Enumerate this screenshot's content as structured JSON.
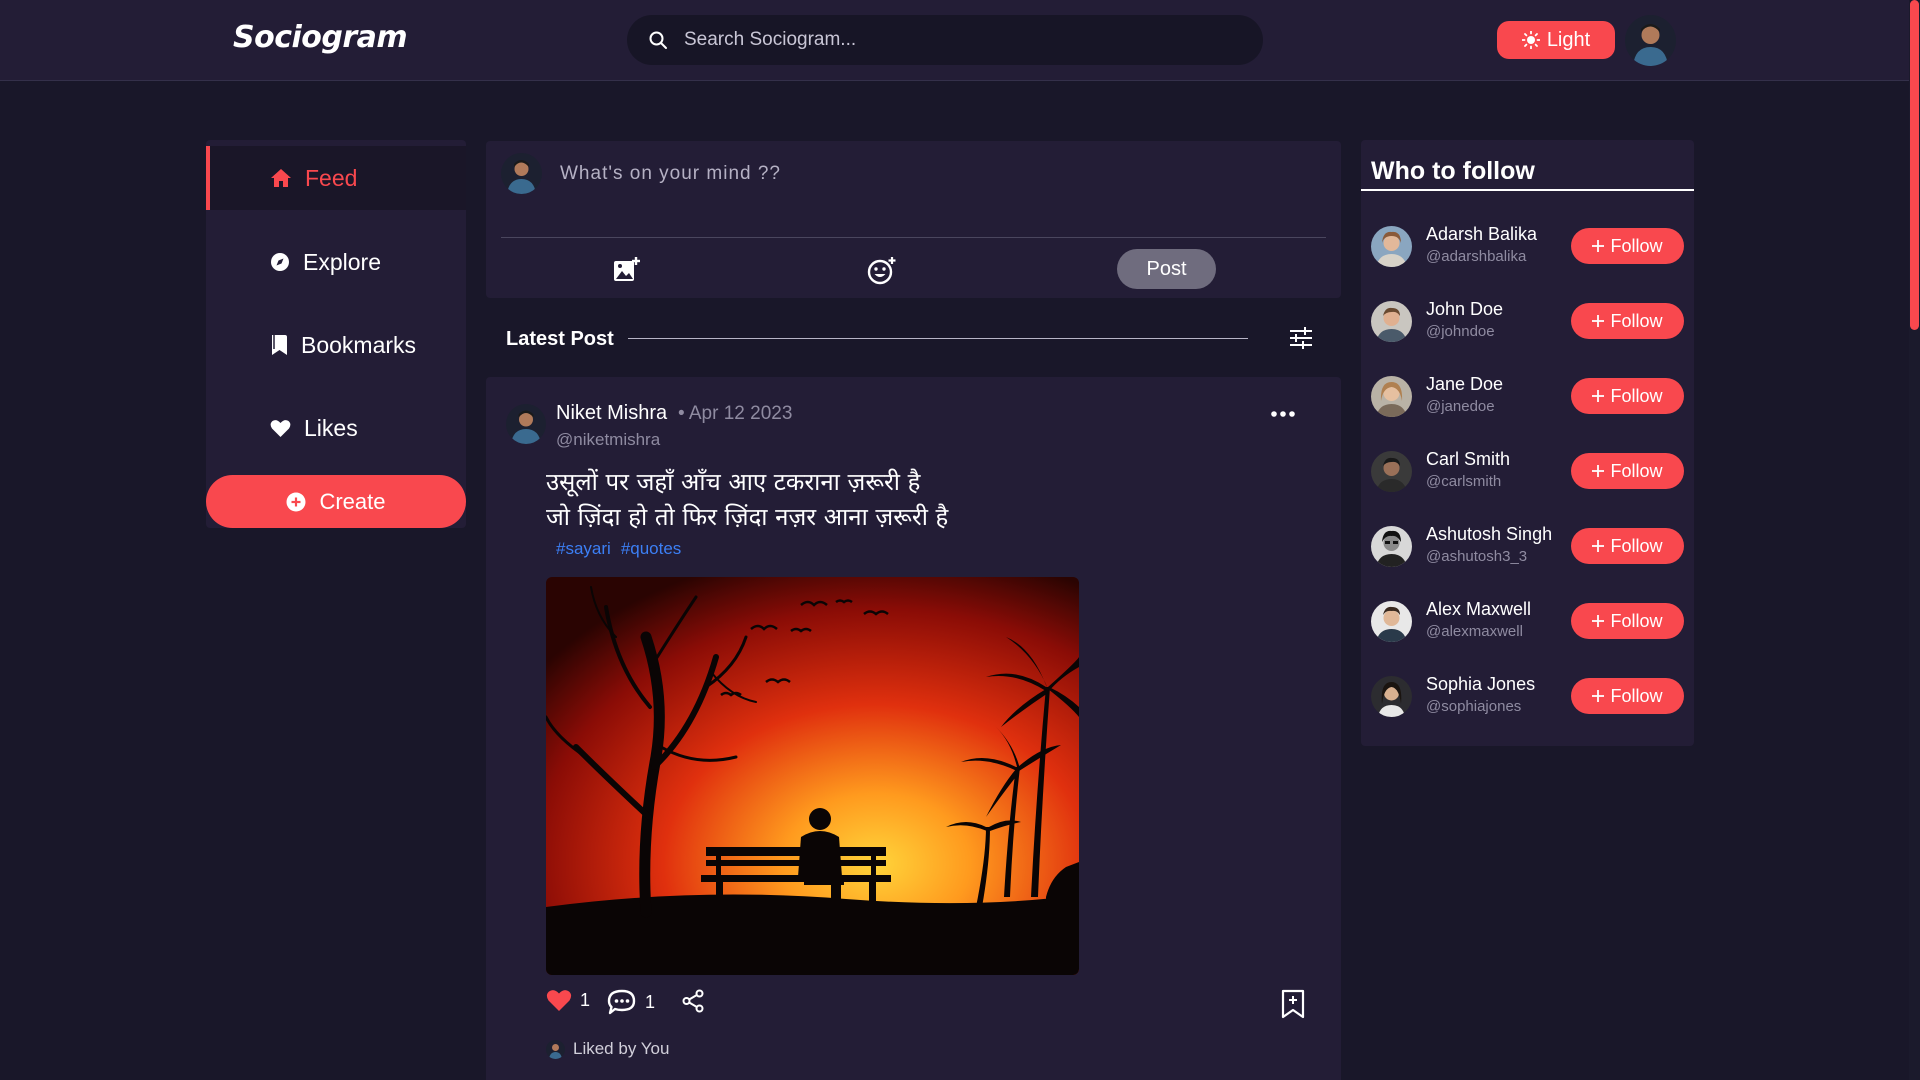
{
  "app": {
    "logo": "Sociogram",
    "theme_button_label": "Light"
  },
  "search": {
    "placeholder": "Search Sociogram..."
  },
  "sidebar": {
    "items": [
      {
        "label": "Feed",
        "icon": "home-icon",
        "active": true
      },
      {
        "label": "Explore",
        "icon": "compass-icon",
        "active": false
      },
      {
        "label": "Bookmarks",
        "icon": "bookmark-icon",
        "active": false
      },
      {
        "label": "Likes",
        "icon": "heart-icon",
        "active": false
      }
    ],
    "create_label": "Create"
  },
  "composer": {
    "placeholder": "What's on your mind ??",
    "post_label": "Post"
  },
  "feed": {
    "header": "Latest Post"
  },
  "post": {
    "author_name": "Niket Mishra",
    "date": "• Apr 12 2023",
    "handle": "@niketmishra",
    "line1": "उसूलों पर जहाँ आँच आए टकराना ज़रूरी है",
    "line2": "जो ज़िंदा हो तो फिर ज़िंदा नज़र आना ज़रूरी है",
    "tags": [
      "#sayari",
      "#quotes"
    ],
    "like_count": "1",
    "comment_count": "1",
    "liked_by": "Liked by You"
  },
  "who_to_follow": {
    "title": "Who to follow",
    "follow_label": "Follow",
    "users": [
      {
        "name": "Adarsh Balika",
        "handle": "@adarshbalika"
      },
      {
        "name": "John Doe",
        "handle": "@johndoe"
      },
      {
        "name": "Jane Doe",
        "handle": "@janedoe"
      },
      {
        "name": "Carl Smith",
        "handle": "@carlsmith"
      },
      {
        "name": "Ashutosh Singh",
        "handle": "@ashutosh3_3"
      },
      {
        "name": "Alex Maxwell",
        "handle": "@alexmaxwell"
      },
      {
        "name": "Sophia Jones",
        "handle": "@sophiajones"
      }
    ]
  },
  "colors": {
    "accent": "#f9484e",
    "background": "#191729",
    "surface": "#231d36",
    "link": "#3c7ff5"
  }
}
